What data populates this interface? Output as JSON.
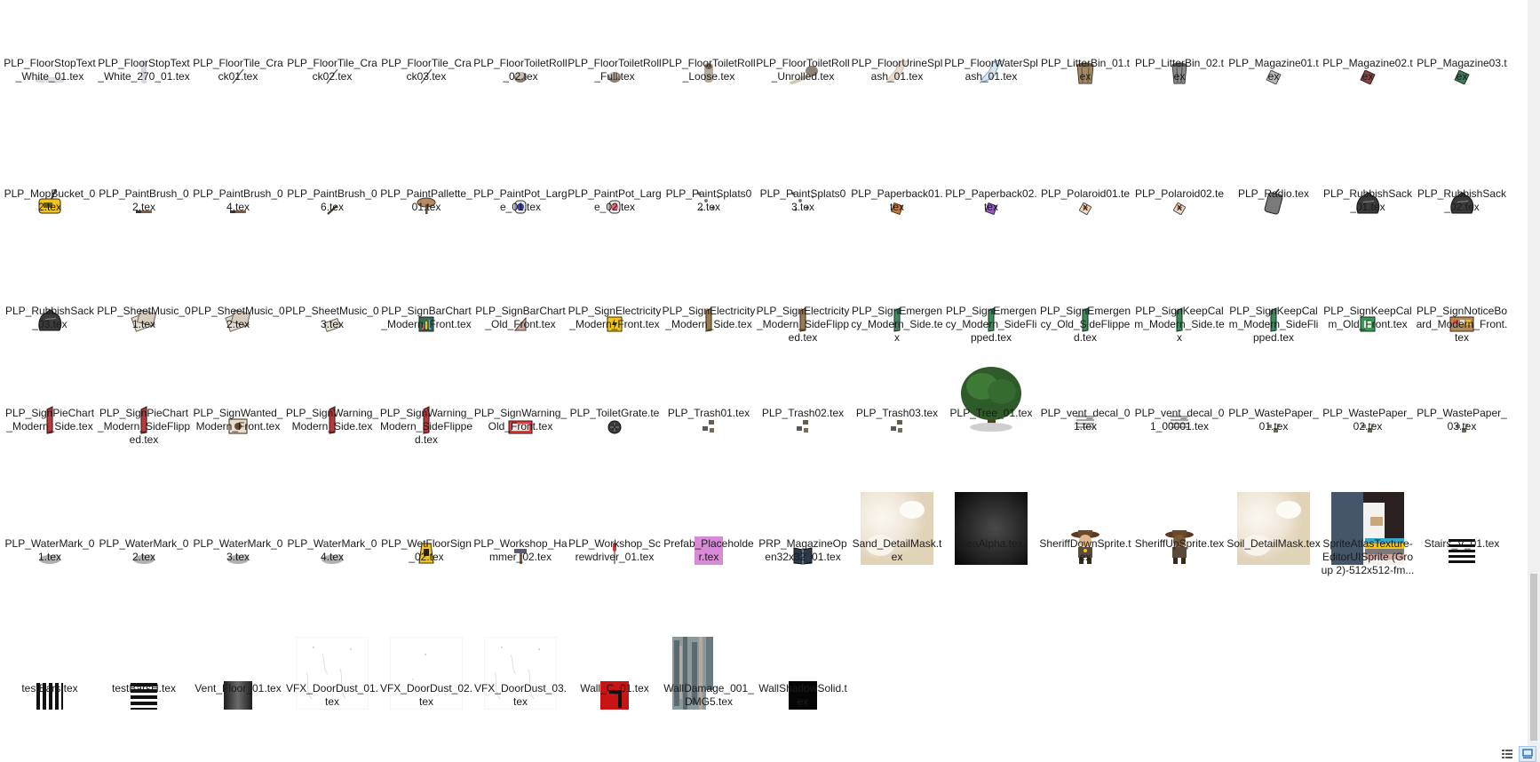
{
  "files": [
    {
      "label": "PLP_FloorStopText_White_01.tex",
      "icon": "stop-text-thumbnail-icon",
      "kind": "stoptext"
    },
    {
      "label": "PLP_FloorStopText_White_270_01.tex",
      "icon": "stop-text-vertical-thumbnail-icon",
      "kind": "stoptextv"
    },
    {
      "label": "PLP_FloorTile_Crack01.tex",
      "icon": "crack-thumbnail-icon",
      "kind": "crack"
    },
    {
      "label": "PLP_FloorTile_Crack02.tex",
      "icon": "crack-thumbnail-icon",
      "kind": "crack"
    },
    {
      "label": "PLP_FloorTile_Crack03.tex",
      "icon": "crack-thumbnail-icon",
      "kind": "crack"
    },
    {
      "label": "PLP_FloorToiletRoll_02.tex",
      "icon": "toilet-roll-thumbnail-icon",
      "kind": "roll"
    },
    {
      "label": "PLP_FloorToiletRoll_Full.tex",
      "icon": "toilet-roll-thumbnail-icon",
      "kind": "roll"
    },
    {
      "label": "PLP_FloorToiletRoll_Loose.tex",
      "icon": "toilet-roll-loose-thumbnail-icon",
      "kind": "rollloose"
    },
    {
      "label": "PLP_FloorToiletRoll_Unrolled.tex",
      "icon": "toilet-roll-unrolled-thumbnail-icon",
      "kind": "rollunrolled"
    },
    {
      "label": "PLP_FloorUrineSplash_01.tex",
      "icon": "urine-splash-thumbnail-icon",
      "kind": "splashbeige"
    },
    {
      "label": "PLP_FloorWaterSplash_01.tex",
      "icon": "water-splash-thumbnail-icon",
      "kind": "splashblue"
    },
    {
      "label": "PLP_LitterBin_01.tex",
      "icon": "litter-bin-thumbnail-icon",
      "kind": "binbrown"
    },
    {
      "label": "PLP_LitterBin_02.tex",
      "icon": "litter-bin-thumbnail-icon",
      "kind": "bingrey"
    },
    {
      "label": "PLP_Magazine01.tex",
      "icon": "magazine-thumbnail-icon",
      "kind": "mag1"
    },
    {
      "label": "PLP_Magazine02.tex",
      "icon": "magazine-thumbnail-icon",
      "kind": "mag2"
    },
    {
      "label": "PLP_Magazine03.tex",
      "icon": "magazine-thumbnail-icon",
      "kind": "mag3"
    },
    {
      "label": "PLP_MopBucket_02.tex",
      "icon": "mop-bucket-thumbnail-icon",
      "kind": "mopbucket"
    },
    {
      "label": "PLP_PaintBrush_02.tex",
      "icon": "paint-brush-thumbnail-icon",
      "kind": "brushflat"
    },
    {
      "label": "PLP_PaintBrush_04.tex",
      "icon": "paint-brush-thumbnail-icon",
      "kind": "brushflat"
    },
    {
      "label": "PLP_PaintBrush_06.tex",
      "icon": "paint-brush-thumbnail-icon",
      "kind": "brushdiag"
    },
    {
      "label": "PLP_PaintPallette_01.tex",
      "icon": "paint-pallette-thumbnail-icon",
      "kind": "pallette"
    },
    {
      "label": "PLP_PaintPot_Large_01.tex",
      "icon": "paint-pot-thumbnail-icon",
      "kind": "potblue"
    },
    {
      "label": "PLP_PaintPot_Large_02.tex",
      "icon": "paint-pot-thumbnail-icon",
      "kind": "potpink"
    },
    {
      "label": "PLP_PaintSplats02.tex",
      "icon": "paint-splats-thumbnail-icon",
      "kind": "splats"
    },
    {
      "label": "PLP_PaintSplats03.tex",
      "icon": "paint-splats-thumbnail-icon",
      "kind": "splats"
    },
    {
      "label": "PLP_Paperback01.tex",
      "icon": "paperback-thumbnail-icon",
      "kind": "paperback1"
    },
    {
      "label": "PLP_Paperback02.tex",
      "icon": "paperback-thumbnail-icon",
      "kind": "paperback2"
    },
    {
      "label": "PLP_Polaroid01.tex",
      "icon": "polaroid-thumbnail-icon",
      "kind": "polaroid"
    },
    {
      "label": "PLP_Polaroid02.tex",
      "icon": "polaroid-thumbnail-icon",
      "kind": "polaroid"
    },
    {
      "label": "PLP_Radio.tex",
      "icon": "radio-thumbnail-icon",
      "kind": "radio"
    },
    {
      "label": "PLP_RubbishSack_01.tex",
      "icon": "rubbish-sack-thumbnail-icon",
      "kind": "sack"
    },
    {
      "label": "PLP_RubbishSack_02.tex",
      "icon": "rubbish-sack-thumbnail-icon",
      "kind": "sack"
    },
    {
      "label": "PLP_RubbishSack_03.tex",
      "icon": "rubbish-sack-thumbnail-icon",
      "kind": "sack"
    },
    {
      "label": "PLP_SheetMusic_01.tex",
      "icon": "sheet-music-thumbnail-icon",
      "kind": "sheet"
    },
    {
      "label": "PLP_SheetMusic_02.tex",
      "icon": "sheet-music-thumbnail-icon",
      "kind": "sheet"
    },
    {
      "label": "PLP_SheetMusic_03.tex",
      "icon": "sheet-music-thumbnail-icon",
      "kind": "sheetsmall"
    },
    {
      "label": "PLP_SignBarChart_Modern_Front.tex",
      "icon": "sign-bar-chart-thumbnail-icon",
      "kind": "signbar"
    },
    {
      "label": "PLP_SignBarChart_Old_Front.tex",
      "icon": "sign-bar-chart-thumbnail-icon",
      "kind": "signbarold"
    },
    {
      "label": "PLP_SignElectricity_Modern_Front.tex",
      "icon": "sign-electricity-thumbnail-icon",
      "kind": "signelec"
    },
    {
      "label": "PLP_SignElectricity_Modern_Side.tex",
      "icon": "sign-side-thumbnail-icon",
      "kind": "sidebrown"
    },
    {
      "label": "PLP_SignElectricity_Modern_SideFlipped.tex",
      "icon": "sign-side-thumbnail-icon",
      "kind": "sidebrown"
    },
    {
      "label": "PLP_SignEmergency_Modern_Side.tex",
      "icon": "sign-side-thumbnail-icon",
      "kind": "sidegreen"
    },
    {
      "label": "PLP_SignEmergency_Modern_SideFlipped.tex",
      "icon": "sign-side-thumbnail-icon",
      "kind": "sidegreen"
    },
    {
      "label": "PLP_SignEmergency_Old_SideFlipped.tex",
      "icon": "sign-side-thumbnail-icon",
      "kind": "sidegreen"
    },
    {
      "label": "PLP_SignKeepCalm_Modern_Side.tex",
      "icon": "sign-side-thumbnail-icon",
      "kind": "sidegreen"
    },
    {
      "label": "PLP_SignKeepCalm_Modern_SideFlipped.tex",
      "icon": "sign-side-thumbnail-icon",
      "kind": "sidegreen"
    },
    {
      "label": "PLP_SignKeepCalm_Old_Front.tex",
      "icon": "sign-keep-calm-thumbnail-icon",
      "kind": "keepcalm"
    },
    {
      "label": "PLP_SignNoticeBoard_Modern_Front.tex",
      "icon": "notice-board-thumbnail-icon",
      "kind": "notice"
    },
    {
      "label": "PLP_SignPieChart_Modern_Side.tex",
      "icon": "sign-side-thumbnail-icon",
      "kind": "sidered"
    },
    {
      "label": "PLP_SignPieChart_Modern_SideFlipped.tex",
      "icon": "sign-side-thumbnail-icon",
      "kind": "sidered"
    },
    {
      "label": "PLP_SignWanted_Modern_Front.tex",
      "icon": "sign-wanted-thumbnail-icon",
      "kind": "wanted"
    },
    {
      "label": "PLP_SignWarning_Modern_Side.tex",
      "icon": "sign-side-thumbnail-icon",
      "kind": "sidered"
    },
    {
      "label": "PLP_SignWarning_Modern_SideFlipped.tex",
      "icon": "sign-side-thumbnail-icon",
      "kind": "sidered"
    },
    {
      "label": "PLP_SignWarning_Old_Front.tex",
      "icon": "sign-warning-thumbnail-icon",
      "kind": "warning"
    },
    {
      "label": "PLP_ToiletGrate.tex",
      "icon": "toilet-grate-thumbnail-icon",
      "kind": "grate"
    },
    {
      "label": "PLP_Trash01.tex",
      "icon": "trash-thumbnail-icon",
      "kind": "trash"
    },
    {
      "label": "PLP_Trash02.tex",
      "icon": "trash-thumbnail-icon",
      "kind": "trash"
    },
    {
      "label": "PLP_Trash03.tex",
      "icon": "trash-thumbnail-icon",
      "kind": "trash"
    },
    {
      "label": "PLP_Tree_01.tex",
      "icon": "tree-thumbnail-icon",
      "kind": "tree"
    },
    {
      "label": "PLP_vent_decal_01.tex",
      "icon": "vent-decal-thumbnail-icon",
      "kind": "vent"
    },
    {
      "label": "PLP_vent_decal_01_00001.tex",
      "icon": "vent-decal-thumbnail-icon",
      "kind": "vent"
    },
    {
      "label": "PLP_WastePaper_01.tex",
      "icon": "waste-paper-thumbnail-icon",
      "kind": "waste"
    },
    {
      "label": "PLP_WastePaper_02.tex",
      "icon": "waste-paper-thumbnail-icon",
      "kind": "waste"
    },
    {
      "label": "PLP_WastePaper_03.tex",
      "icon": "waste-paper-thumbnail-icon",
      "kind": "waste"
    },
    {
      "label": "PLP_WaterMark_01.tex",
      "icon": "water-mark-thumbnail-icon",
      "kind": "watermark"
    },
    {
      "label": "PLP_WaterMark_02.tex",
      "icon": "water-mark-thumbnail-icon",
      "kind": "watermark"
    },
    {
      "label": "PLP_WaterMark_03.tex",
      "icon": "water-mark-thumbnail-icon",
      "kind": "watermark"
    },
    {
      "label": "PLP_WaterMark_04.tex",
      "icon": "water-mark-thumbnail-icon",
      "kind": "watermark"
    },
    {
      "label": "PLP_WetFloorSign_02.tex",
      "icon": "wet-floor-sign-thumbnail-icon",
      "kind": "wetfloor"
    },
    {
      "label": "PLP_Workshop_Hammer_02.tex",
      "icon": "hammer-thumbnail-icon",
      "kind": "hammer"
    },
    {
      "label": "PLP_Workshop_Screwdriver_01.tex",
      "icon": "screwdriver-thumbnail-icon",
      "kind": "screwdriver"
    },
    {
      "label": "Prefab_Placeholder.tex",
      "icon": "placeholder-thumbnail-icon",
      "kind": "placeholder"
    },
    {
      "label": "PRP_MagazineOpen32x32_01.tex",
      "icon": "magazine-open-thumbnail-icon",
      "kind": "magopen"
    },
    {
      "label": "Sand_DetailMask.tex",
      "icon": "sand-mask-thumbnail-icon",
      "kind": "sand"
    },
    {
      "label": "SeaAlpha.tex",
      "icon": "sea-alpha-thumbnail-icon",
      "kind": "sea"
    },
    {
      "label": "SheriffDownSprite.tex",
      "icon": "sheriff-sprite-thumbnail-icon",
      "kind": "sheriff"
    },
    {
      "label": "SheriffUpSprite.tex",
      "icon": "sheriff-sprite-thumbnail-icon",
      "kind": "sheriffup"
    },
    {
      "label": "Soil_DetailMask.tex",
      "icon": "soil-mask-thumbnail-icon",
      "kind": "sand"
    },
    {
      "label": "SpriteAtlasTexture-EditorUISprite (Group 2)-512x512-fm...",
      "icon": "sprite-atlas-thumbnail-icon",
      "kind": "atlas"
    },
    {
      "label": "Stairs_V_01.tex",
      "icon": "stairs-thumbnail-icon",
      "kind": "stairs"
    },
    {
      "label": "testBars.tex",
      "icon": "test-bars-thumbnail-icon",
      "kind": "vbars"
    },
    {
      "label": "testBarsH.tex",
      "icon": "test-bars-horizontal-thumbnail-icon",
      "kind": "hbars"
    },
    {
      "label": "Vent_Floor_01.tex",
      "icon": "vent-floor-thumbnail-icon",
      "kind": "ventfloor"
    },
    {
      "label": "VFX_DoorDust_01.tex",
      "icon": "door-dust-thumbnail-icon",
      "kind": "dust"
    },
    {
      "label": "VFX_DoorDust_02.tex",
      "icon": "door-dust-thumbnail-icon",
      "kind": "dust2"
    },
    {
      "label": "VFX_DoorDust_03.tex",
      "icon": "door-dust-thumbnail-icon",
      "kind": "dust"
    },
    {
      "label": "Wall_C_01.tex",
      "icon": "wall-thumbnail-icon",
      "kind": "wallc"
    },
    {
      "label": "WallDamage_001_DMG5.tex",
      "icon": "wall-damage-thumbnail-icon",
      "kind": "walldamage"
    },
    {
      "label": "WallShadowSolid.tex",
      "icon": "wall-shadow-thumbnail-icon",
      "kind": "blacksq"
    }
  ],
  "colors": {
    "text": "#1b1b1b",
    "scroll_track": "#f0f0f0",
    "scroll_thumb": "#c6c6c6",
    "accent": "#0078d7"
  },
  "status_bar": {
    "details_view_icon": "details-view-icon",
    "large_icons_view_icon": "large-icons-view-icon"
  }
}
